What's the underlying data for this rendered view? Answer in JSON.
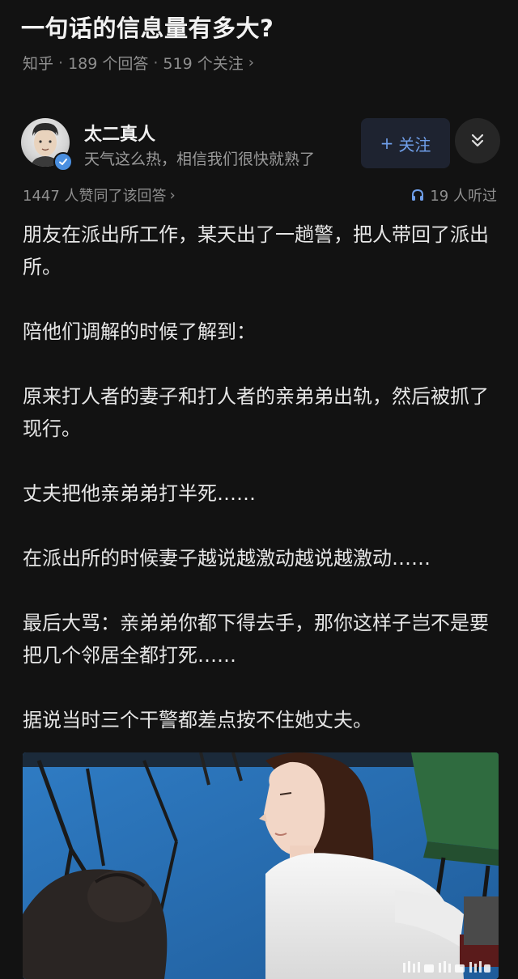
{
  "question": {
    "title": "一句话的信息量有多大?",
    "source": "知乎",
    "answers": "189 个回答",
    "followers": "519 个关注"
  },
  "author": {
    "name": "太二真人",
    "bio": "天气这么热，相信我们很快就熟了",
    "follow_label": "关注",
    "follow_plus": "+"
  },
  "stats": {
    "likes": "1447 人赞同了该回答",
    "listens": "19 人听过"
  },
  "paragraphs": [
    "朋友在派出所工作，某天出了一趟警，把人带回了派出所。",
    "陪他们调解的时候了解到：",
    "原来打人者的妻子和打人者的亲弟弟出轨，然后被抓了现行。",
    "丈夫把他亲弟弟打半死……",
    "在派出所的时候妻子越说越激动越说越激动……",
    "最后大骂：亲弟弟你都下得去手，那你这样子岂不是要把几个邻居全都打死……",
    "据说当时三个干警都差点按不住她丈夫。"
  ],
  "icons": {
    "chevron": "chevron-right-icon",
    "collapse": "double-chevron-down-icon",
    "headphones": "headphones-icon",
    "verified": "verified-badge-icon"
  },
  "colors": {
    "background": "#121212",
    "accent": "#6f9ee8",
    "verified": "#4a8fe0"
  }
}
